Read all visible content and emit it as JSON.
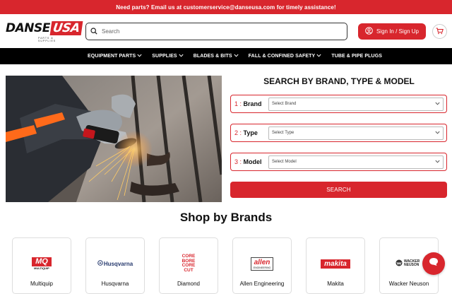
{
  "announcement": "Need parts? Email us at customerservice@danseusa.com for timely assistance!",
  "logo": {
    "brand_main": "DANSE",
    "brand_accent": "USA",
    "tagline": "PARTS & SUPPLIES"
  },
  "search": {
    "placeholder": "Search"
  },
  "header": {
    "signin_label": "Sign In / Sign Up"
  },
  "nav": {
    "items": [
      {
        "label": "EQUIPMENT PARTS"
      },
      {
        "label": "SUPPLIES"
      },
      {
        "label": "BLADES & BITS"
      },
      {
        "label": "FALL & CONFINED SAFETY"
      },
      {
        "label": "TUBE & PIPE PLUGS"
      }
    ]
  },
  "finder": {
    "title": "SEARCH BY BRAND, TYPE & MODEL",
    "rows": [
      {
        "num": "1 :",
        "label": "Brand",
        "placeholder": "Select Brand"
      },
      {
        "num": "2 :",
        "label": "Type",
        "placeholder": "Select Type"
      },
      {
        "num": "3 :",
        "label": "Model",
        "placeholder": "Select Model"
      }
    ],
    "search_label": "SEARCH"
  },
  "brands": {
    "title": "Shop by Brands",
    "items": [
      {
        "name": "Multiquip",
        "logo_text": "MQ",
        "logo_sub": "MULTIQUIP"
      },
      {
        "name": "Husqvarna",
        "logo_text": "Husqvarna"
      },
      {
        "name": "Diamond",
        "logo_text": "CORE BORE CORE CUT"
      },
      {
        "name": "Allen Engineering",
        "logo_text": "allen",
        "logo_sub": "ENGINEERING"
      },
      {
        "name": "Makita",
        "logo_text": "makita"
      },
      {
        "name": "Wacker Neuson",
        "logo_text": "WACKER NEUSON"
      }
    ]
  },
  "colors": {
    "accent": "#d8262d",
    "nav_bg": "#000000"
  }
}
